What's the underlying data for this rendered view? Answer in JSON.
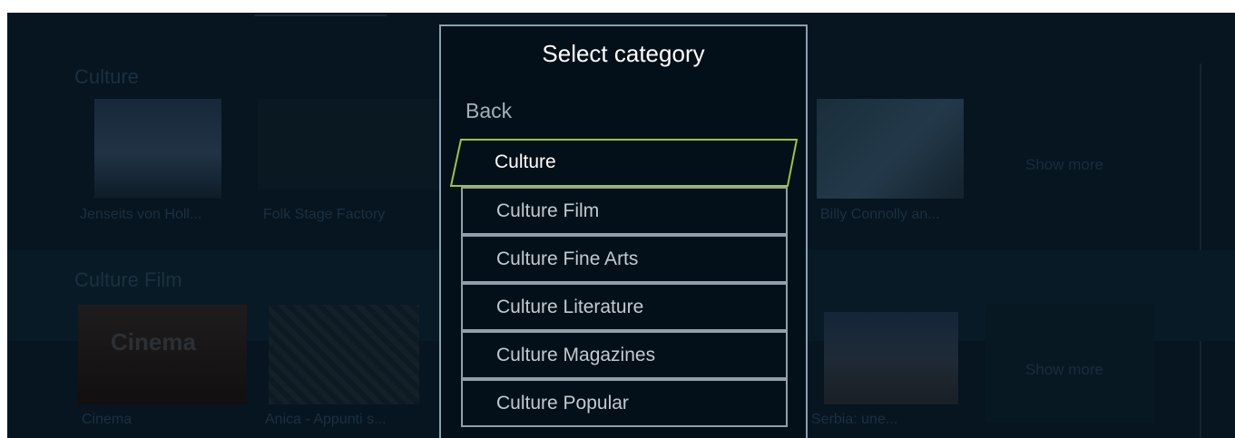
{
  "background": {
    "sections": [
      {
        "title": "Culture",
        "tiles": [
          {
            "caption": "Jenseits von Holl..."
          },
          {
            "caption": "Folk Stage Factory"
          },
          {
            "caption": "Billy Connolly an..."
          }
        ],
        "show_more": "Show more"
      },
      {
        "title": "Culture Film",
        "tiles": [
          {
            "caption": "Cinema",
            "art_text": "Cinema"
          },
          {
            "caption": "Anica - Appunti s..."
          },
          {
            "caption": "Serbia: une..."
          }
        ],
        "show_more": "Show more"
      }
    ]
  },
  "dialog": {
    "title": "Select category",
    "back_label": "Back",
    "items": [
      {
        "label": "Culture",
        "selected": true
      },
      {
        "label": "Culture Film"
      },
      {
        "label": "Culture Fine Arts"
      },
      {
        "label": "Culture Literature"
      },
      {
        "label": "Culture Magazines"
      },
      {
        "label": "Culture Popular"
      }
    ]
  },
  "colors": {
    "background": "#061520",
    "dialog_bg": "#031019",
    "focus_border": "#9bc53d",
    "item_border": "#8fa0ab"
  }
}
